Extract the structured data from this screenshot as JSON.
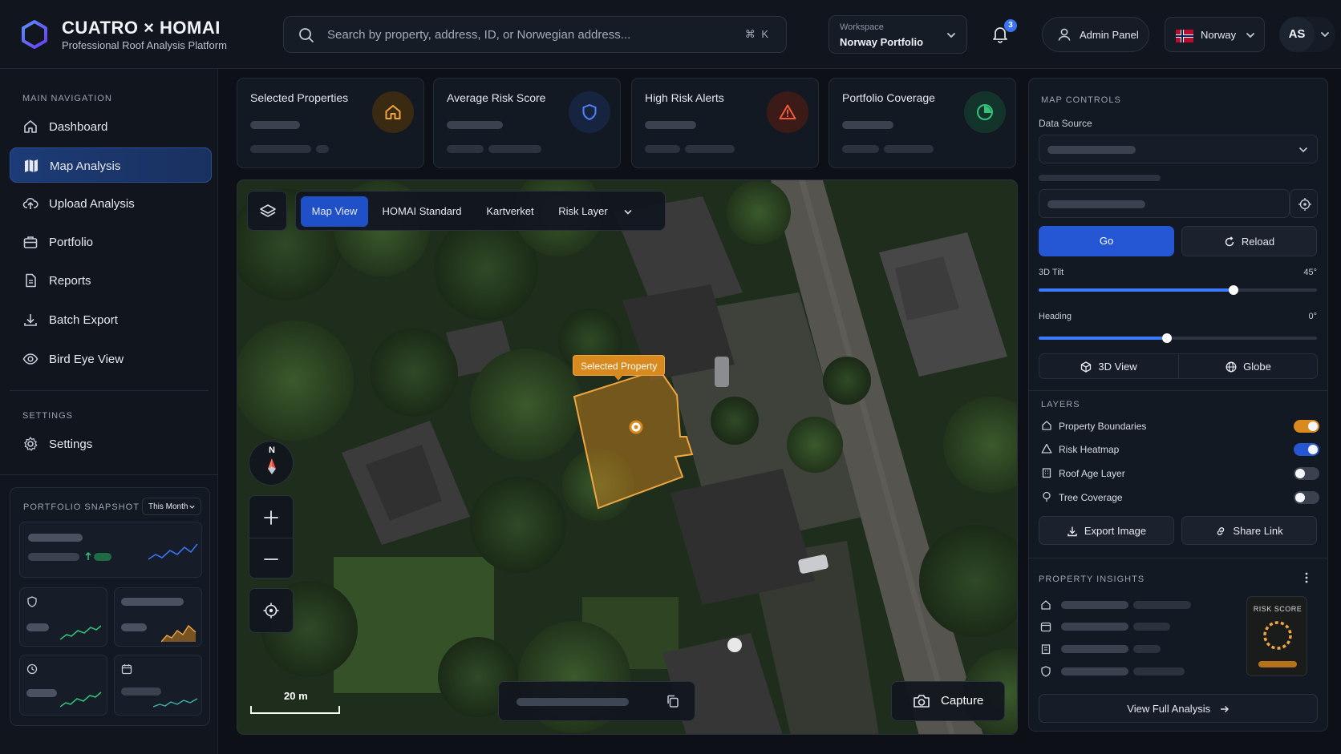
{
  "brand": {
    "title": "CUATRO × HOMAI",
    "subtitle": "Professional Roof Analysis Platform"
  },
  "search": {
    "placeholder": "Search by property, address, ID, or Norwegian address...",
    "shortcut": "⌘ K"
  },
  "workspace": {
    "label": "Workspace",
    "value": "Norway Portfolio"
  },
  "notifications": {
    "count": "3"
  },
  "admin": {
    "label": "Admin Panel"
  },
  "country": {
    "label": "Norway"
  },
  "user": {
    "initials": "AS"
  },
  "sidebar": {
    "main_label": "MAIN NAVIGATION",
    "items": [
      {
        "label": "Dashboard",
        "icon": "home-icon"
      },
      {
        "label": "Map Analysis",
        "icon": "map-icon",
        "active": true
      },
      {
        "label": "Upload Analysis",
        "icon": "cloud-upload-icon"
      },
      {
        "label": "Portfolio",
        "icon": "briefcase-icon"
      },
      {
        "label": "Reports",
        "icon": "document-icon"
      },
      {
        "label": "Batch Export",
        "icon": "download-icon"
      },
      {
        "label": "Bird Eye View",
        "icon": "eye-icon"
      }
    ],
    "settings_label": "SETTINGS",
    "settings_item": {
      "label": "Settings",
      "icon": "gear-icon"
    }
  },
  "snapshot": {
    "title": "PORTFOLIO SNAPSHOT",
    "period": "This Month"
  },
  "stats": [
    {
      "title": "Selected Properties",
      "icon": "home-icon",
      "color": "#f0a640"
    },
    {
      "title": "Average Risk Score",
      "icon": "shield-icon",
      "color": "#3b73f0"
    },
    {
      "title": "High Risk Alerts",
      "icon": "warning-icon",
      "color": "#f05a3b"
    },
    {
      "title": "Portfolio Coverage",
      "icon": "pie-chart-icon",
      "color": "#34c27a"
    }
  ],
  "map": {
    "tabs": [
      "Map View",
      "HOMAI Standard",
      "Kartverket",
      "Risk Layer"
    ],
    "active_tab": "Map View",
    "selected_label": "Selected Property",
    "compass_label": "N",
    "scale_label": "20 m",
    "capture_label": "Capture"
  },
  "controls": {
    "title": "MAP CONTROLS",
    "data_source_label": "Data Source",
    "go_label": "Go",
    "reload_label": "Reload",
    "tilt_label": "3D Tilt",
    "tilt_value": "45°",
    "tilt_fraction": 0.7,
    "heading_label": "Heading",
    "heading_value": "0°",
    "heading_fraction": 0.46,
    "view3d_label": "3D View",
    "globe_label": "Globe"
  },
  "layers": {
    "title": "LAYERS",
    "items": [
      {
        "label": "Property Boundaries",
        "icon": "home-icon",
        "on": true,
        "color": "orange"
      },
      {
        "label": "Risk Heatmap",
        "icon": "alert-icon",
        "on": true,
        "color": "blue"
      },
      {
        "label": "Roof Age Layer",
        "icon": "building-icon",
        "on": false
      },
      {
        "label": "Tree Coverage",
        "icon": "tree-icon",
        "on": false
      }
    ],
    "export_label": "Export Image",
    "share_label": "Share Link"
  },
  "insights": {
    "title": "PROPERTY INSIGHTS",
    "risk_label": "RISK SCORE",
    "view_full_label": "View Full Analysis"
  }
}
